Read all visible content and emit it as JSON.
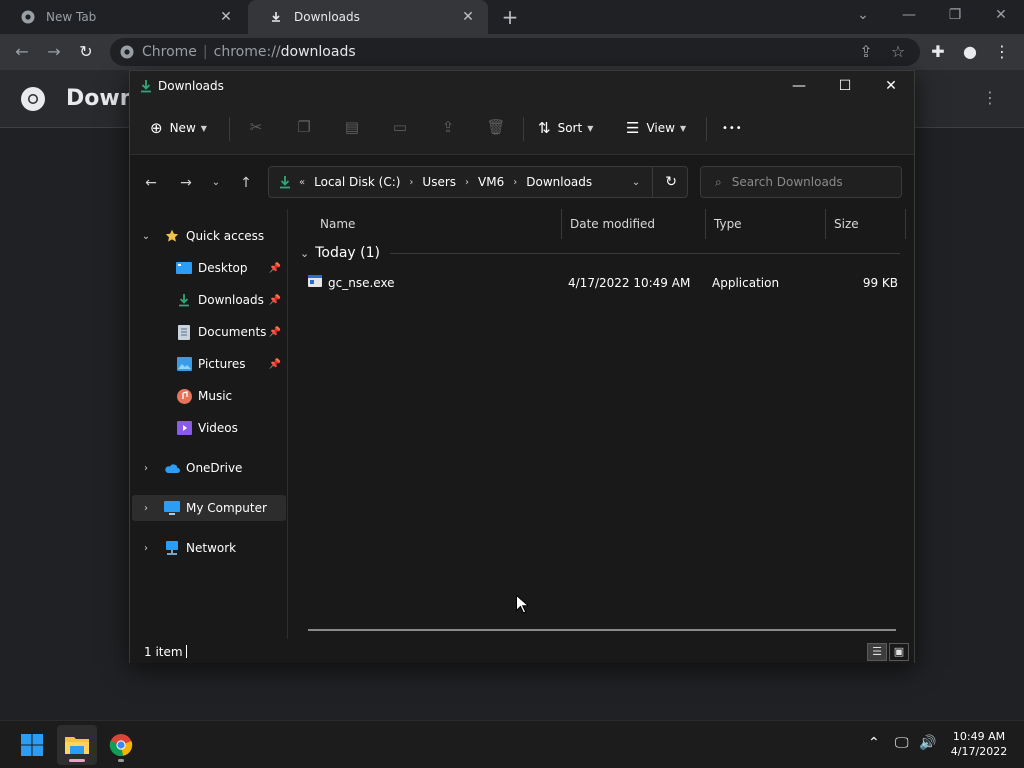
{
  "browser": {
    "tabs": [
      {
        "label": "New Tab",
        "active": false
      },
      {
        "label": "Downloads",
        "active": true
      }
    ],
    "omnibox": {
      "site": "Chrome",
      "scheme": "chrome://",
      "host": "downloads"
    },
    "page_title": "Downl"
  },
  "explorer": {
    "title": "Downloads",
    "commands": {
      "new": "New",
      "sort": "Sort",
      "view": "View",
      "more": "•••"
    },
    "address": {
      "overflow": "«",
      "crumbs": [
        "Local Disk (C:)",
        "Users",
        "VM6",
        "Downloads"
      ]
    },
    "search_placeholder": "Search Downloads",
    "nav": {
      "quick_access": "Quick access",
      "items": [
        "Desktop",
        "Downloads",
        "Documents",
        "Pictures",
        "Music",
        "Videos"
      ],
      "onedrive": "OneDrive",
      "my_computer": "My Computer",
      "network": "Network"
    },
    "columns": [
      "Name",
      "Date modified",
      "Type",
      "Size"
    ],
    "group": "Today (1)",
    "files": [
      {
        "name": "gc_nse.exe",
        "date": "4/17/2022 10:49 AM",
        "type": "Application",
        "size": "99 KB"
      }
    ],
    "status": "1 item"
  },
  "taskbar": {
    "time": "10:49 AM",
    "date": "4/17/2022"
  },
  "colors": {
    "accent_green": "#2ea879",
    "folder_yellow": "#f3c24b",
    "windows_blue": "#2b9df4"
  }
}
